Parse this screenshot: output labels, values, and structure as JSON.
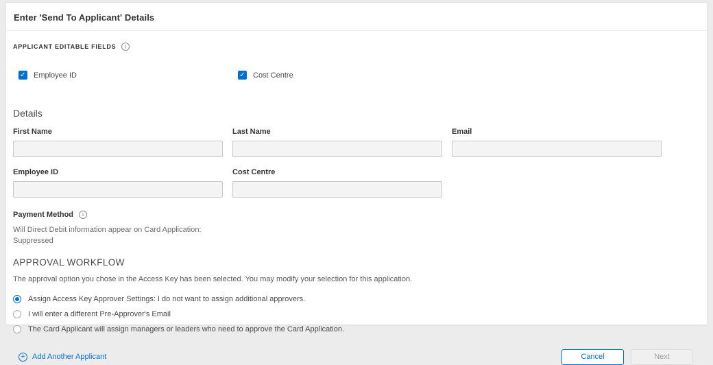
{
  "page": {
    "title": "Enter 'Send To Applicant' Details"
  },
  "applicant_editable_fields": {
    "heading": "APPLICANT EDITABLE FIELDS",
    "info_icon": "i",
    "checkboxes": [
      {
        "label": "Employee ID",
        "checked": true
      },
      {
        "label": "Cost Centre",
        "checked": true
      }
    ],
    "check_glyph": "✓"
  },
  "details": {
    "heading": "Details",
    "fields": [
      {
        "label": "First Name",
        "value": ""
      },
      {
        "label": "Last Name",
        "value": ""
      },
      {
        "label": "Email",
        "value": ""
      },
      {
        "label": "Employee ID",
        "value": ""
      },
      {
        "label": "Cost Centre",
        "value": ""
      }
    ]
  },
  "payment_method": {
    "heading": "Payment Method",
    "info_icon": "i",
    "line1": "Will Direct Debit information appear on Card Application:",
    "line2": "Suppressed"
  },
  "approval_workflow": {
    "heading": "APPROVAL WORKFLOW",
    "description": "The approval option you chose in the Access Key has been selected. You may modify your selection for this application.",
    "options": [
      {
        "label": "Assign Access Key Approver Settings: I do not want to assign additional approvers.",
        "selected": true
      },
      {
        "label": "I will enter a different Pre-Approver's Email",
        "selected": false
      },
      {
        "label": "The Card Applicant will assign managers or leaders who need to approve the Card Application.",
        "selected": false
      }
    ]
  },
  "footer": {
    "add_applicant_label": "Add Another Applicant",
    "plus_glyph": "+",
    "cancel_label": "Cancel",
    "next_label": "Next"
  },
  "colors": {
    "accent_blue": "#006fcf",
    "card_background": "#ffffff",
    "page_background": "#ececec",
    "input_background": "#f4f4f4",
    "disabled_button_text": "#9e9e9e"
  }
}
